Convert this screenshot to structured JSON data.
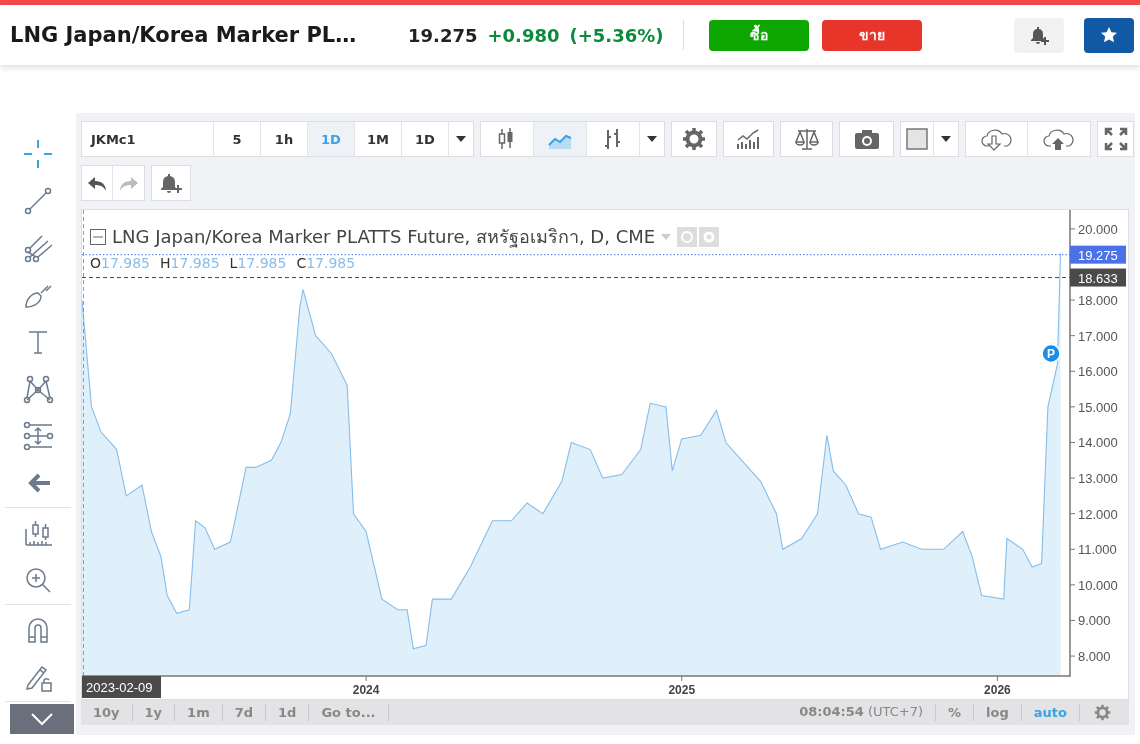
{
  "header": {
    "title": "LNG Japan/Korea Marker PL…",
    "price": "19.275",
    "change": "+0.980",
    "change_percent": "(+5.36%)",
    "buy_label": "ซื้อ",
    "sell_label": "ขาย"
  },
  "left_tools": [
    [
      {
        "kind": "crosshair",
        "selected": true
      },
      {
        "kind": "trendline",
        "selected": false
      },
      {
        "kind": "fork",
        "selected": false
      },
      {
        "kind": "brush",
        "selected": false
      },
      {
        "kind": "text",
        "selected": false
      },
      {
        "kind": "pattern",
        "selected": false
      },
      {
        "kind": "measure",
        "selected": false
      },
      {
        "kind": "back",
        "selected": false
      }
    ],
    [
      {
        "kind": "candle-ruler",
        "selected": false
      },
      {
        "kind": "zoom",
        "selected": false
      }
    ],
    [
      {
        "kind": "magnet",
        "selected": false
      },
      {
        "kind": "lock",
        "selected": false
      }
    ]
  ],
  "toolbar": {
    "symbol": "JKMc1",
    "intervals": [
      {
        "label": "5",
        "selected": false
      },
      {
        "label": "1h",
        "selected": false
      },
      {
        "label": "1D",
        "selected": true
      },
      {
        "label": "1M",
        "selected": false
      },
      {
        "label": "1D",
        "selected": false
      }
    ],
    "chart_types": [
      {
        "kind": "candles",
        "selected": false
      },
      {
        "kind": "area",
        "selected": true
      },
      {
        "kind": "bars",
        "selected": false
      }
    ],
    "history": [
      {
        "kind": "undo",
        "disabled": false
      },
      {
        "kind": "redo",
        "disabled": true
      }
    ]
  },
  "legend": {
    "title": "LNG Japan/Korea Marker PLATTS Future, สหรัฐอเมริกา, D, CME",
    "ohlc": [
      {
        "label": "O",
        "value": "17.985"
      },
      {
        "label": "H",
        "value": "17.985"
      },
      {
        "label": "L",
        "value": "17.985"
      },
      {
        "label": "C",
        "value": "17.985"
      }
    ]
  },
  "chart": {
    "crosshair_date": "2023-02-09",
    "chart_data": {
      "type": "area",
      "xlim": [
        2023.1,
        2026.23
      ],
      "ylim": [
        7.44,
        20.53
      ],
      "xticks": [
        {
          "value": 2024,
          "label": "2024"
        },
        {
          "value": 2025,
          "label": "2025"
        },
        {
          "value": 2026,
          "label": "2026"
        }
      ],
      "yticks": [
        {
          "value": 8,
          "label": "8.000"
        },
        {
          "value": 9,
          "label": "9.000"
        },
        {
          "value": 10,
          "label": "10.000"
        },
        {
          "value": 11,
          "label": "11.000"
        },
        {
          "value": 12,
          "label": "12.000"
        },
        {
          "value": 13,
          "label": "13.000"
        },
        {
          "value": 14,
          "label": "14.000"
        },
        {
          "value": 15,
          "label": "15.000"
        },
        {
          "value": 16,
          "label": "16.000"
        },
        {
          "value": 17,
          "label": "17.000"
        },
        {
          "value": 18,
          "label": "18.000"
        },
        {
          "value": 20,
          "label": "20.000"
        }
      ],
      "x": [
        2023.1,
        2023.13,
        2023.16,
        2023.21,
        2023.24,
        2023.29,
        2023.32,
        2023.35,
        2023.37,
        2023.4,
        2023.44,
        2023.46,
        2023.49,
        2023.52,
        2023.57,
        2023.62,
        2023.65,
        2023.7,
        2023.73,
        2023.76,
        2023.79,
        2023.8,
        2023.84,
        2023.89,
        2023.94,
        2023.96,
        2024.0,
        2024.05,
        2024.1,
        2024.13,
        2024.15,
        2024.19,
        2024.21,
        2024.27,
        2024.33,
        2024.4,
        2024.46,
        2024.51,
        2024.56,
        2024.62,
        2024.65,
        2024.71,
        2024.75,
        2024.81,
        2024.87,
        2024.9,
        2024.95,
        2024.97,
        2025.0,
        2025.06,
        2025.11,
        2025.14,
        2025.19,
        2025.25,
        2025.3,
        2025.32,
        2025.38,
        2025.43,
        2025.46,
        2025.48,
        2025.52,
        2025.56,
        2025.6,
        2025.63,
        2025.7,
        2025.76,
        2025.83,
        2025.89,
        2025.92,
        2025.95,
        2026.02,
        2026.03,
        2026.08,
        2026.11,
        2026.14,
        2026.16,
        2026.19,
        2026.2
      ],
      "series": [
        {
          "color": "#85bdec",
          "values": [
            18.0,
            15.0,
            14.3,
            13.8,
            12.5,
            12.8,
            11.5,
            10.8,
            9.7,
            9.2,
            9.3,
            11.8,
            11.6,
            11.0,
            11.2,
            13.3,
            13.3,
            13.5,
            14.0,
            14.8,
            17.8,
            18.3,
            17.0,
            16.5,
            15.6,
            12.0,
            11.5,
            9.6,
            9.3,
            9.3,
            8.2,
            8.3,
            9.6,
            9.6,
            10.5,
            11.8,
            11.8,
            12.3,
            12.0,
            12.9,
            14.0,
            13.8,
            13.0,
            13.1,
            13.8,
            15.1,
            15.0,
            13.2,
            14.1,
            14.2,
            14.9,
            14.0,
            13.5,
            12.9,
            12.0,
            11.0,
            11.3,
            12.0,
            14.2,
            13.2,
            12.8,
            12.0,
            11.9,
            11.0,
            11.2,
            11.0,
            11.0,
            11.5,
            10.8,
            9.7,
            9.6,
            11.3,
            11.0,
            10.5,
            10.6,
            15.0,
            16.2,
            19.3
          ]
        }
      ],
      "ref_lines": [
        {
          "axis": "y",
          "value": 19.275,
          "label": "19.275",
          "color": "#4a72e6"
        },
        {
          "axis": "y",
          "value": 18.633,
          "label": "18.633",
          "color": "#4a4a4a"
        }
      ],
      "annotations": [
        {
          "text": "P",
          "x": 2026.17,
          "y": 16.5
        }
      ]
    }
  },
  "bottom_bar": {
    "ranges": [
      "10y",
      "1y",
      "1m",
      "7d",
      "1d",
      "Go to..."
    ],
    "time": "**08:04:54** (UTC+7)",
    "scales": [
      {
        "label": "%",
        "selected": false
      },
      {
        "label": "log",
        "selected": false
      },
      {
        "label": "auto",
        "selected": true
      }
    ]
  }
}
